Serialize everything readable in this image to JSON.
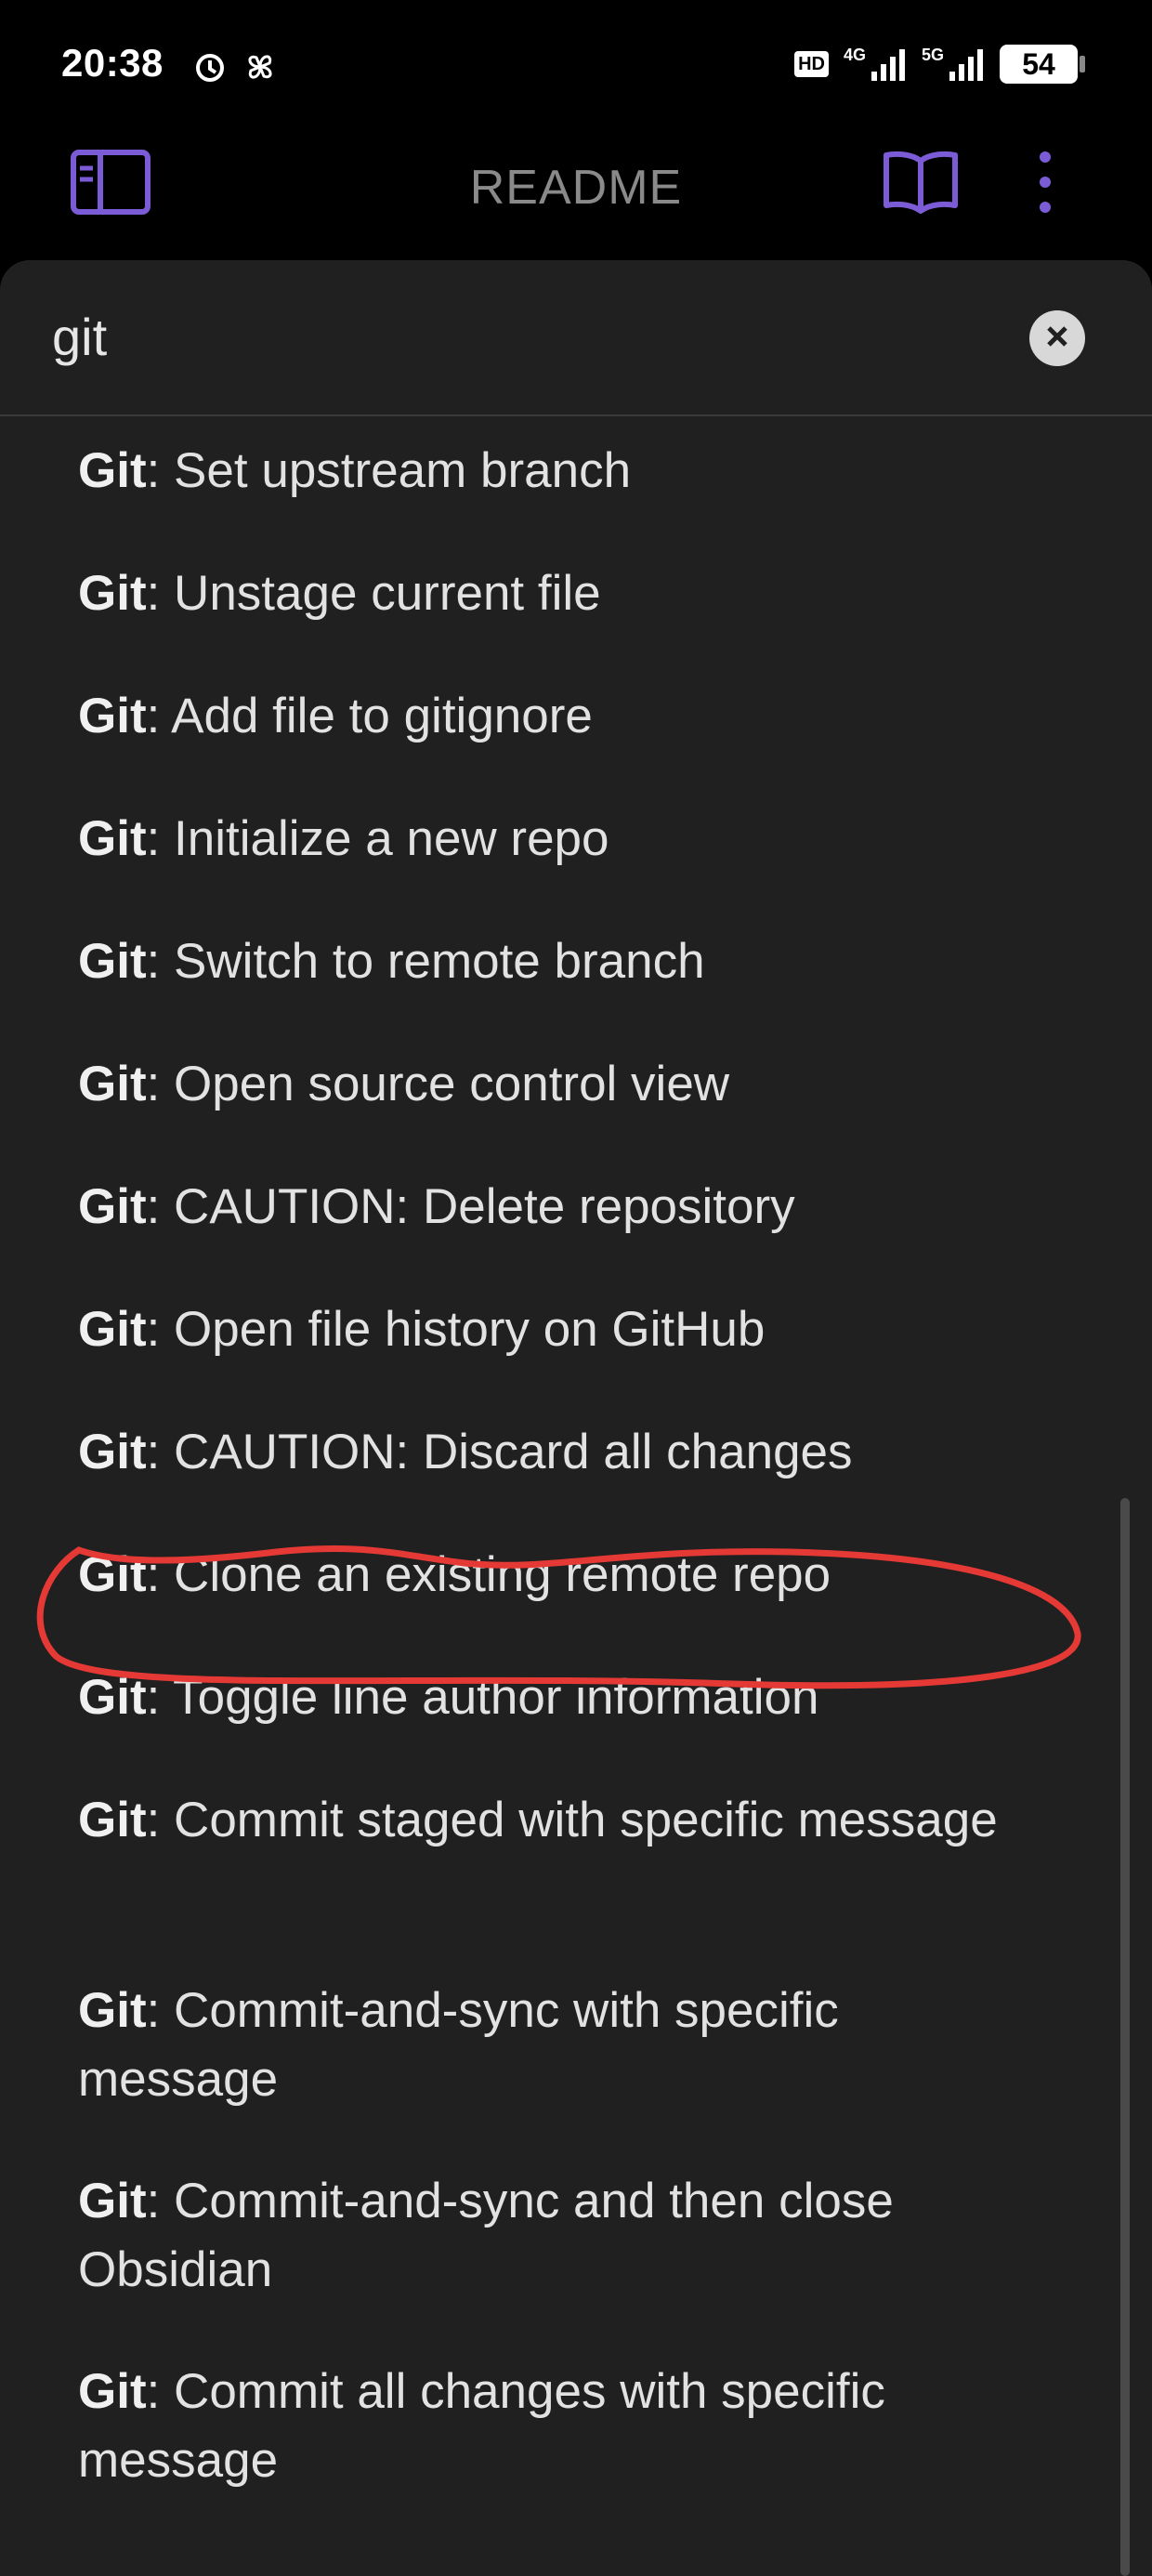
{
  "status_bar": {
    "time": "20:38",
    "hd_label": "HD",
    "net1": "4G",
    "net2": "5G",
    "battery": "54"
  },
  "header": {
    "title": "README",
    "accent_color": "#7b5cd6"
  },
  "search": {
    "value": "git"
  },
  "results": [
    {
      "prefix": "Git",
      "text": ": Set upstream branch"
    },
    {
      "prefix": "Git",
      "text": ": Unstage current file"
    },
    {
      "prefix": "Git",
      "text": ": Add file to gitignore"
    },
    {
      "prefix": "Git",
      "text": ": Initialize a new repo"
    },
    {
      "prefix": "Git",
      "text": ": Switch to remote branch"
    },
    {
      "prefix": "Git",
      "text": ": Open source control view"
    },
    {
      "prefix": "Git",
      "text": ": CAUTION: Delete repository"
    },
    {
      "prefix": "Git",
      "text": ": Open file history on GitHub"
    },
    {
      "prefix": "Git",
      "text": ": CAUTION: Discard all changes"
    },
    {
      "prefix": "Git",
      "text": ": Clone an existing remote repo"
    },
    {
      "prefix": "Git",
      "text": ": Toggle line author information"
    },
    {
      "prefix": "Git",
      "text": ": Commit staged with specific message"
    },
    {
      "prefix": "Git",
      "text": ": Commit-and-sync with specific message"
    },
    {
      "prefix": "Git",
      "text": ": Commit-and-sync and then close Obsidian"
    },
    {
      "prefix": "Git",
      "text": ": Commit all changes with specific message"
    }
  ],
  "annotation_color": "#e53935"
}
